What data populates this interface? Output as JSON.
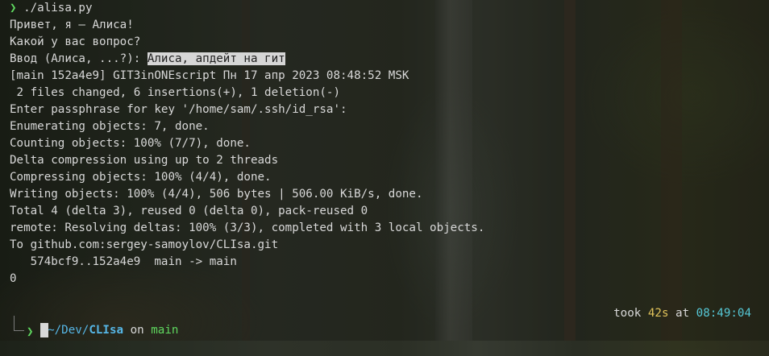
{
  "command": {
    "arrow": "❯",
    "text": " ./alisa.py"
  },
  "output": {
    "l1": "Привет, я – Алиса!",
    "l2": "Какой у вас вопрос?",
    "l3_prompt": "Ввод (Алиса, ...?): ",
    "l3_input": "Алиса, апдейт на гит",
    "l4": "[main 152a4e9] GIT3inONEscript Пн 17 апр 2023 08:48:52 MSK",
    "l5": " 2 files changed, 6 insertions(+), 1 deletion(-)",
    "l6": "Enter passphrase for key '/home/sam/.ssh/id_rsa':",
    "l7": "Enumerating objects: 7, done.",
    "l8": "Counting objects: 100% (7/7), done.",
    "l9": "Delta compression using up to 2 threads",
    "l10": "Compressing objects: 100% (4/4), done.",
    "l11": "Writing objects: 100% (4/4), 506 bytes | 506.00 KiB/s, done.",
    "l12": "Total 4 (delta 3), reused 0 (delta 0), pack-reused 0",
    "l13": "remote: Resolving deltas: 100% (3/3), completed with 3 local objects.",
    "l14": "To github.com:sergey-samoylov/CLIsa.git",
    "l15": "   574bcf9..152a4e9  main -> main",
    "l16": "0"
  },
  "status": {
    "path": "~/Dev/",
    "repo": "CLIsa",
    "on": " on ",
    "branch": "main",
    "took": "took ",
    "duration": "42s",
    "at": " at ",
    "time": "08:49:04"
  },
  "prompt": {
    "arrow": "❯"
  }
}
